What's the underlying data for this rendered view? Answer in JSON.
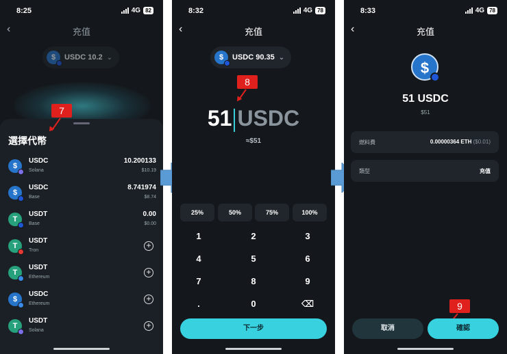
{
  "screen1": {
    "status": {
      "time": "8:25",
      "network": "4G",
      "battery": "82"
    },
    "title": "充值",
    "pill": {
      "label": "USDC 10.2"
    },
    "marker": "7",
    "sheet_title": "選擇代幣",
    "tokens": [
      {
        "symbol": "USDC",
        "network": "Solana",
        "balance": "10.200133",
        "fiat": "$10.19",
        "icon": "usdc-solana-icon"
      },
      {
        "symbol": "USDC",
        "network": "Base",
        "balance": "8.741974",
        "fiat": "$8.74",
        "icon": "usdc-base-icon"
      },
      {
        "symbol": "USDT",
        "network": "Base",
        "balance": "0.00",
        "fiat": "$0.00",
        "icon": "usdt-base-icon"
      },
      {
        "symbol": "USDT",
        "network": "Tron",
        "add": "+",
        "icon": "usdt-tron-icon"
      },
      {
        "symbol": "USDT",
        "network": "Ethereum",
        "add": "+",
        "icon": "usdt-ethereum-icon"
      },
      {
        "symbol": "USDC",
        "network": "Ethereum",
        "add": "+",
        "icon": "usdc-ethereum-icon"
      },
      {
        "symbol": "USDT",
        "network": "Solana",
        "add": "+",
        "icon": "usdt-solana-icon"
      }
    ]
  },
  "screen2": {
    "status": {
      "time": "8:32",
      "network": "4G",
      "battery": "78"
    },
    "title": "充值",
    "pill": {
      "label": "USDC 90.35"
    },
    "marker": "8",
    "amount": "51",
    "unit": "USDC",
    "approx": "≈$51",
    "percent_buttons": [
      "25%",
      "50%",
      "75%",
      "100%"
    ],
    "keypad": [
      "1",
      "2",
      "3",
      "4",
      "5",
      "6",
      "7",
      "8",
      "9",
      ".",
      "0",
      "⌫"
    ],
    "next_label": "下一步"
  },
  "screen3": {
    "status": {
      "time": "8:33",
      "network": "4G",
      "battery": "78"
    },
    "title": "充值",
    "amount": "51 USDC",
    "fiat": "$51",
    "fee": {
      "label": "燃料費",
      "value": "0.00000364 ETH",
      "fiat": "($0.01)"
    },
    "type": {
      "label": "類型",
      "value": "充值"
    },
    "marker": "9",
    "cancel_label": "取消",
    "confirm_label": "確認"
  },
  "colors": {
    "accent": "#37d1e0",
    "marker": "#e0201c",
    "flow_arrow": "#5b9bd5",
    "usdc": "#2775ca",
    "usdt": "#26a17b"
  }
}
